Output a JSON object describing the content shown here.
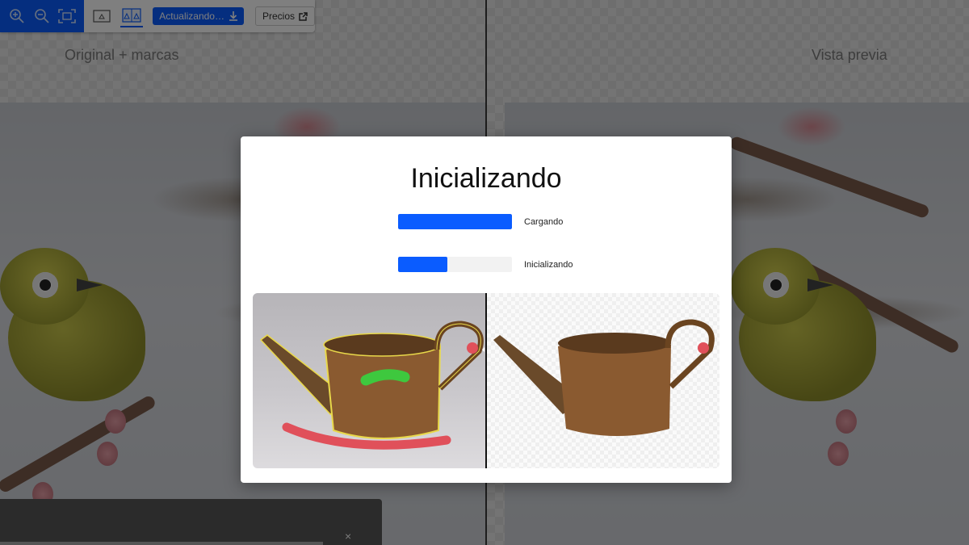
{
  "toolbar": {
    "zoom_in_icon": "zoom-in-icon",
    "zoom_out_icon": "zoom-out-icon",
    "fit_icon": "fit-screen-icon",
    "single_view_icon": "single-view-icon",
    "split_view_icon": "split-view-icon",
    "update_label": "Actualizando…",
    "prices_label": "Precios",
    "accent_color": "#0a5cff"
  },
  "panes": {
    "left_label": "Original + marcas",
    "right_label": "Vista previa"
  },
  "modal": {
    "title": "Inicializando",
    "progress": [
      {
        "label": "Cargando",
        "value": 1.0
      },
      {
        "label": "Inicializando",
        "value": 0.43
      }
    ]
  },
  "toast": {
    "close_label": "×"
  }
}
